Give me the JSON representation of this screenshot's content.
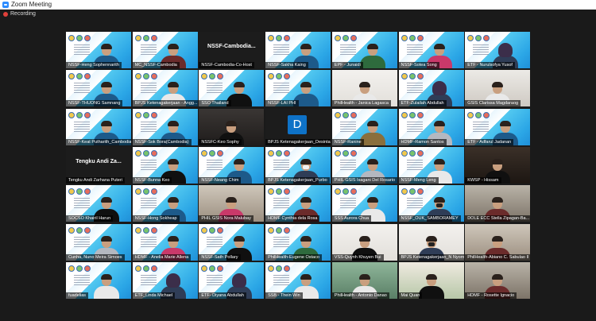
{
  "window": {
    "title": "Zoom Meeting",
    "recording_label": "Recording"
  },
  "participants": [
    {
      "name": "NSSF-Heng Sophennarith",
      "style": "banner",
      "person": "c4"
    },
    {
      "name": "MC_NSSF-Cambodia",
      "style": "banner",
      "person": "c2",
      "active": true
    },
    {
      "name": "NSSF-Cambodia-Co-Host",
      "style": "plain",
      "title": "NSSF-Cambodia..."
    },
    {
      "name": "NSSF-Sakha Kaing",
      "style": "banner",
      "person": "c4"
    },
    {
      "name": "EPF - Junaidi",
      "style": "banner",
      "person": "c5"
    },
    {
      "name": "NSSF-Sotea Song",
      "style": "banner",
      "person": "c9"
    },
    {
      "name": "ETF - Nurulsofya Yusof",
      "style": "banner",
      "person": "hj"
    },
    {
      "name": "NSSF-THUONG Samnang",
      "style": "banner",
      "person": "c4"
    },
    {
      "name": "BPJS Ketenagakerjaan - Angg...",
      "style": "banner",
      "person": "c3"
    },
    {
      "name": "SSO Thailand",
      "style": "banner",
      "person": "c6"
    },
    {
      "name": "NSSF-LAI PHI",
      "style": "banner",
      "person": "c4"
    },
    {
      "name": "PhilHealth - Janica Lagasca",
      "style": "white",
      "person": "c3"
    },
    {
      "name": "ETF-Zulailah Abdullah",
      "style": "banner",
      "person": "hj"
    },
    {
      "name": "GSIS Clarissa Magdaraog",
      "style": "light",
      "person": "c3"
    },
    {
      "name": "NSSF-Keat Putharith_Cambodia",
      "style": "banner",
      "person": "c4"
    },
    {
      "name": "NSSF-Sok Bora(Cambodia)",
      "style": "banner",
      "person": "c4"
    },
    {
      "name": "NSSFC-Keo Sophy",
      "style": "dark",
      "person": "c6"
    },
    {
      "name": "BPJS Ketenagakerjaan_Desinta",
      "style": "plain",
      "avatar": "D"
    },
    {
      "name": "NSSF-Ranine",
      "style": "banner",
      "person": "c7"
    },
    {
      "name": "HDMF-Ramon Santos",
      "style": "banner",
      "person": "c8"
    },
    {
      "name": "ETF - Adfarul Jadanan",
      "style": "banner",
      "person": "c4"
    },
    {
      "name": "Tengku Andi Zarhana Puteri",
      "style": "plain",
      "title": "Tengku Andi Za..."
    },
    {
      "name": "NSSF-Bunna Keo",
      "style": "banner",
      "person": "c6"
    },
    {
      "name": "NSSF-Neang Chim",
      "style": "banner",
      "person": "c4"
    },
    {
      "name": "BPJS Ketenagakerjaan_Purbo",
      "style": "banner",
      "person": "mask"
    },
    {
      "name": "PHIL GSIS Isagani Del Rosario",
      "style": "banner",
      "person": "c8"
    },
    {
      "name": "NSSF-Meng Leng",
      "style": "banner",
      "person": "c3"
    },
    {
      "name": "KWSP - Hissam",
      "style": "kiwi",
      "person": "c6"
    },
    {
      "name": "SOCSO Khairil Harun",
      "style": "banner",
      "person": "c6"
    },
    {
      "name": "NSSF-Hong Sokheap",
      "style": "banner",
      "person": "c4"
    },
    {
      "name": "PHIL GSIS Nora Malubay",
      "style": "office",
      "person": "c9"
    },
    {
      "name": "HDMF Cynthia dela Rosa",
      "style": "banner",
      "person": "c2"
    },
    {
      "name": "SSS Aurora Chua",
      "style": "banner",
      "person": "c3"
    },
    {
      "name": "NSSF_OUK_SAMBORAMEY",
      "style": "banner",
      "person": "mask2"
    },
    {
      "name": "DOLE ECC Stella Zipagan-Ba...",
      "style": "room",
      "person": "c2"
    },
    {
      "name": "Cunha, Nuno Meira Simoes",
      "style": "banner",
      "person": "c8"
    },
    {
      "name": "HDMF - Anelia Marie Allena",
      "style": "banner",
      "person": "c9"
    },
    {
      "name": "NSSF-Sath Pollary",
      "style": "banner",
      "person": "c6"
    },
    {
      "name": "PhilHealth-Eugene Ostaco",
      "style": "banner",
      "person": "c5"
    },
    {
      "name": "VSS-Quynh Khuyen Bui",
      "style": "white",
      "person": "c6"
    },
    {
      "name": "BPJS Ketenagakerjaan_N Nyoman",
      "style": "white",
      "person": "mask2"
    },
    {
      "name": "PhilHealth-Abiano C. Sabulao II",
      "style": "office",
      "person": "c2"
    },
    {
      "name": "fuadelias",
      "style": "banner",
      "person": "c3"
    },
    {
      "name": "ETF_Linda Michael",
      "style": "banner",
      "person": "hj"
    },
    {
      "name": "ETF- Diyana Abdullah",
      "style": "banner",
      "person": "hj"
    },
    {
      "name": "SSB - Thein Win",
      "style": "banner",
      "person": "c3"
    },
    {
      "name": "PhilHealth - Antonio Danao",
      "style": "green",
      "person": "c3"
    },
    {
      "name": "Mai Quan",
      "style": "plant",
      "person": "c6"
    },
    {
      "name": "HDMF - Rosette Ignacio",
      "style": "room",
      "person": "c2"
    }
  ]
}
